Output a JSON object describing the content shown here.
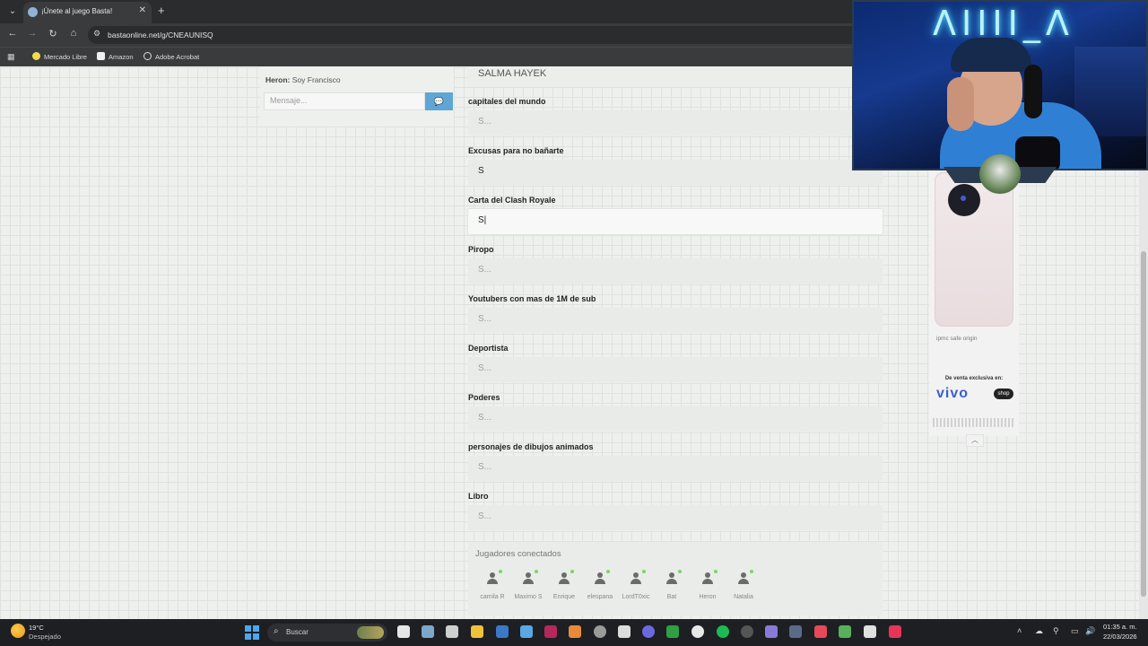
{
  "browser": {
    "tab_title": "¡Únete al juego Basta!",
    "tab_close": "✕",
    "new_tab": "+",
    "url": "bastaonline.net/g/CNEAUNISQ",
    "bookmarks": [
      "Mercado Libre",
      "Amazon",
      "Adobe Acrobat"
    ]
  },
  "chat": {
    "sender": "Heron:",
    "message": "Soy Francisco",
    "input_placeholder": "Mensaje..."
  },
  "prev_answer": "SALMA HAYEK",
  "fields": [
    {
      "label": "capitales del mundo",
      "value": "",
      "placeholder": "S..."
    },
    {
      "label": "Excusas para no bañarte",
      "value": "S",
      "placeholder": "S..."
    },
    {
      "label": "Carta del Clash Royale",
      "value": "S|",
      "placeholder": "S..."
    },
    {
      "label": "Piropo",
      "value": "",
      "placeholder": "S..."
    },
    {
      "label": "Youtubers con mas de 1M de sub",
      "value": "",
      "placeholder": "S..."
    },
    {
      "label": "Deportista",
      "value": "",
      "placeholder": "S..."
    },
    {
      "label": "Poderes",
      "value": "",
      "placeholder": "S..."
    },
    {
      "label": "personajes de dibujos animados",
      "value": "",
      "placeholder": "S..."
    },
    {
      "label": "Libro",
      "value": "",
      "placeholder": "S..."
    }
  ],
  "players": {
    "title": "Jugadores conectados",
    "names": [
      "camila R",
      "Maximo S",
      "Enrique",
      "elespana",
      "LordT0xic",
      "Bat",
      "Heron",
      "Natalia"
    ]
  },
  "ad": {
    "badges": "ipmc  safe  origin",
    "exclusive": "De venta exclusiva en:",
    "brand": "vivo",
    "shop": "shop"
  },
  "stream_overlay": {
    "neon_text": "ΛΙΙΙΙ_Λ"
  },
  "taskbar": {
    "temp": "19°C",
    "weather": "Despejado",
    "search_label": "Buscar",
    "time": "01:35 a. m.",
    "date": "22/03/2026"
  }
}
